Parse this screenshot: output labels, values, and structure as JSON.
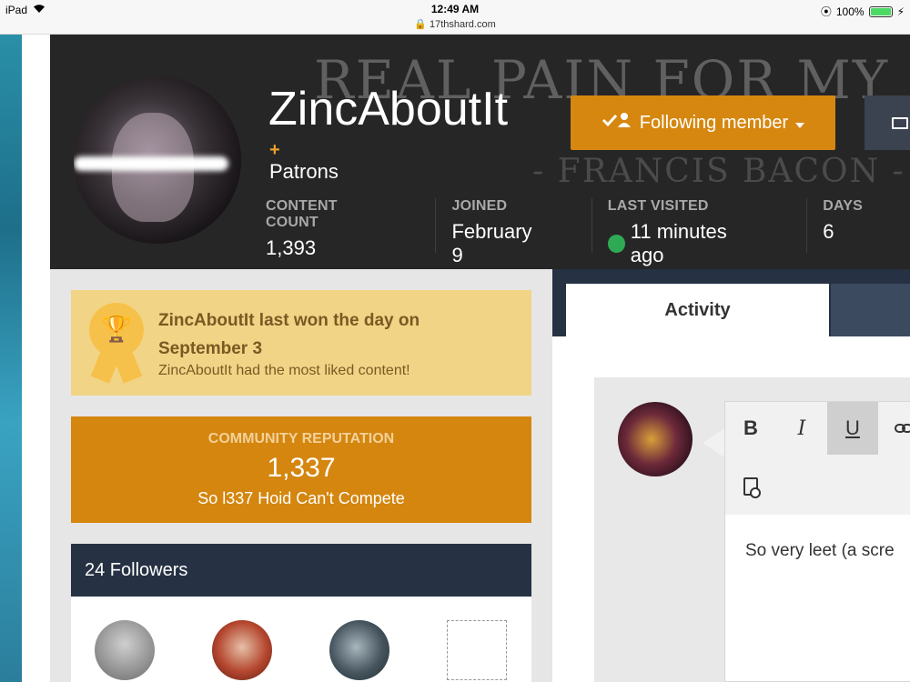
{
  "statusbar": {
    "device": "iPad",
    "time": "12:49 AM",
    "url": "17thshard.com",
    "battery": "100%"
  },
  "profile": {
    "cover_line1": "REAL PAIN FOR MY SHAM F",
    "cover_line2": "- FRANCIS BACON -",
    "username": "ZincAboutIt",
    "plus": "+",
    "group": "Patrons",
    "follow_label": "Following member",
    "stats": [
      {
        "label": "Content Count",
        "value": "1,393"
      },
      {
        "label": "Joined",
        "value": "February 9"
      },
      {
        "label": "Last Visited",
        "value": "11 minutes ago"
      },
      {
        "label": "Days",
        "value": "6"
      }
    ]
  },
  "day_winner": {
    "title": "ZincAboutIt last won the day on September 3",
    "subtitle": "ZincAboutIt had the most liked content!"
  },
  "reputation": {
    "label": "Community Reputation",
    "value": "1,337",
    "description": "So l337 Hoid Can't Compete"
  },
  "followers": {
    "title": "24 Followers"
  },
  "tabs": {
    "activity": "Activity"
  },
  "editor": {
    "bold": "B",
    "italic": "I",
    "underline": "U",
    "link_icon": "link-icon",
    "preview_icon": "preview-icon",
    "text": "So very leet (a scre"
  },
  "colors": {
    "accent": "#d6870f",
    "navy": "#263243",
    "online": "#2eaa55"
  }
}
